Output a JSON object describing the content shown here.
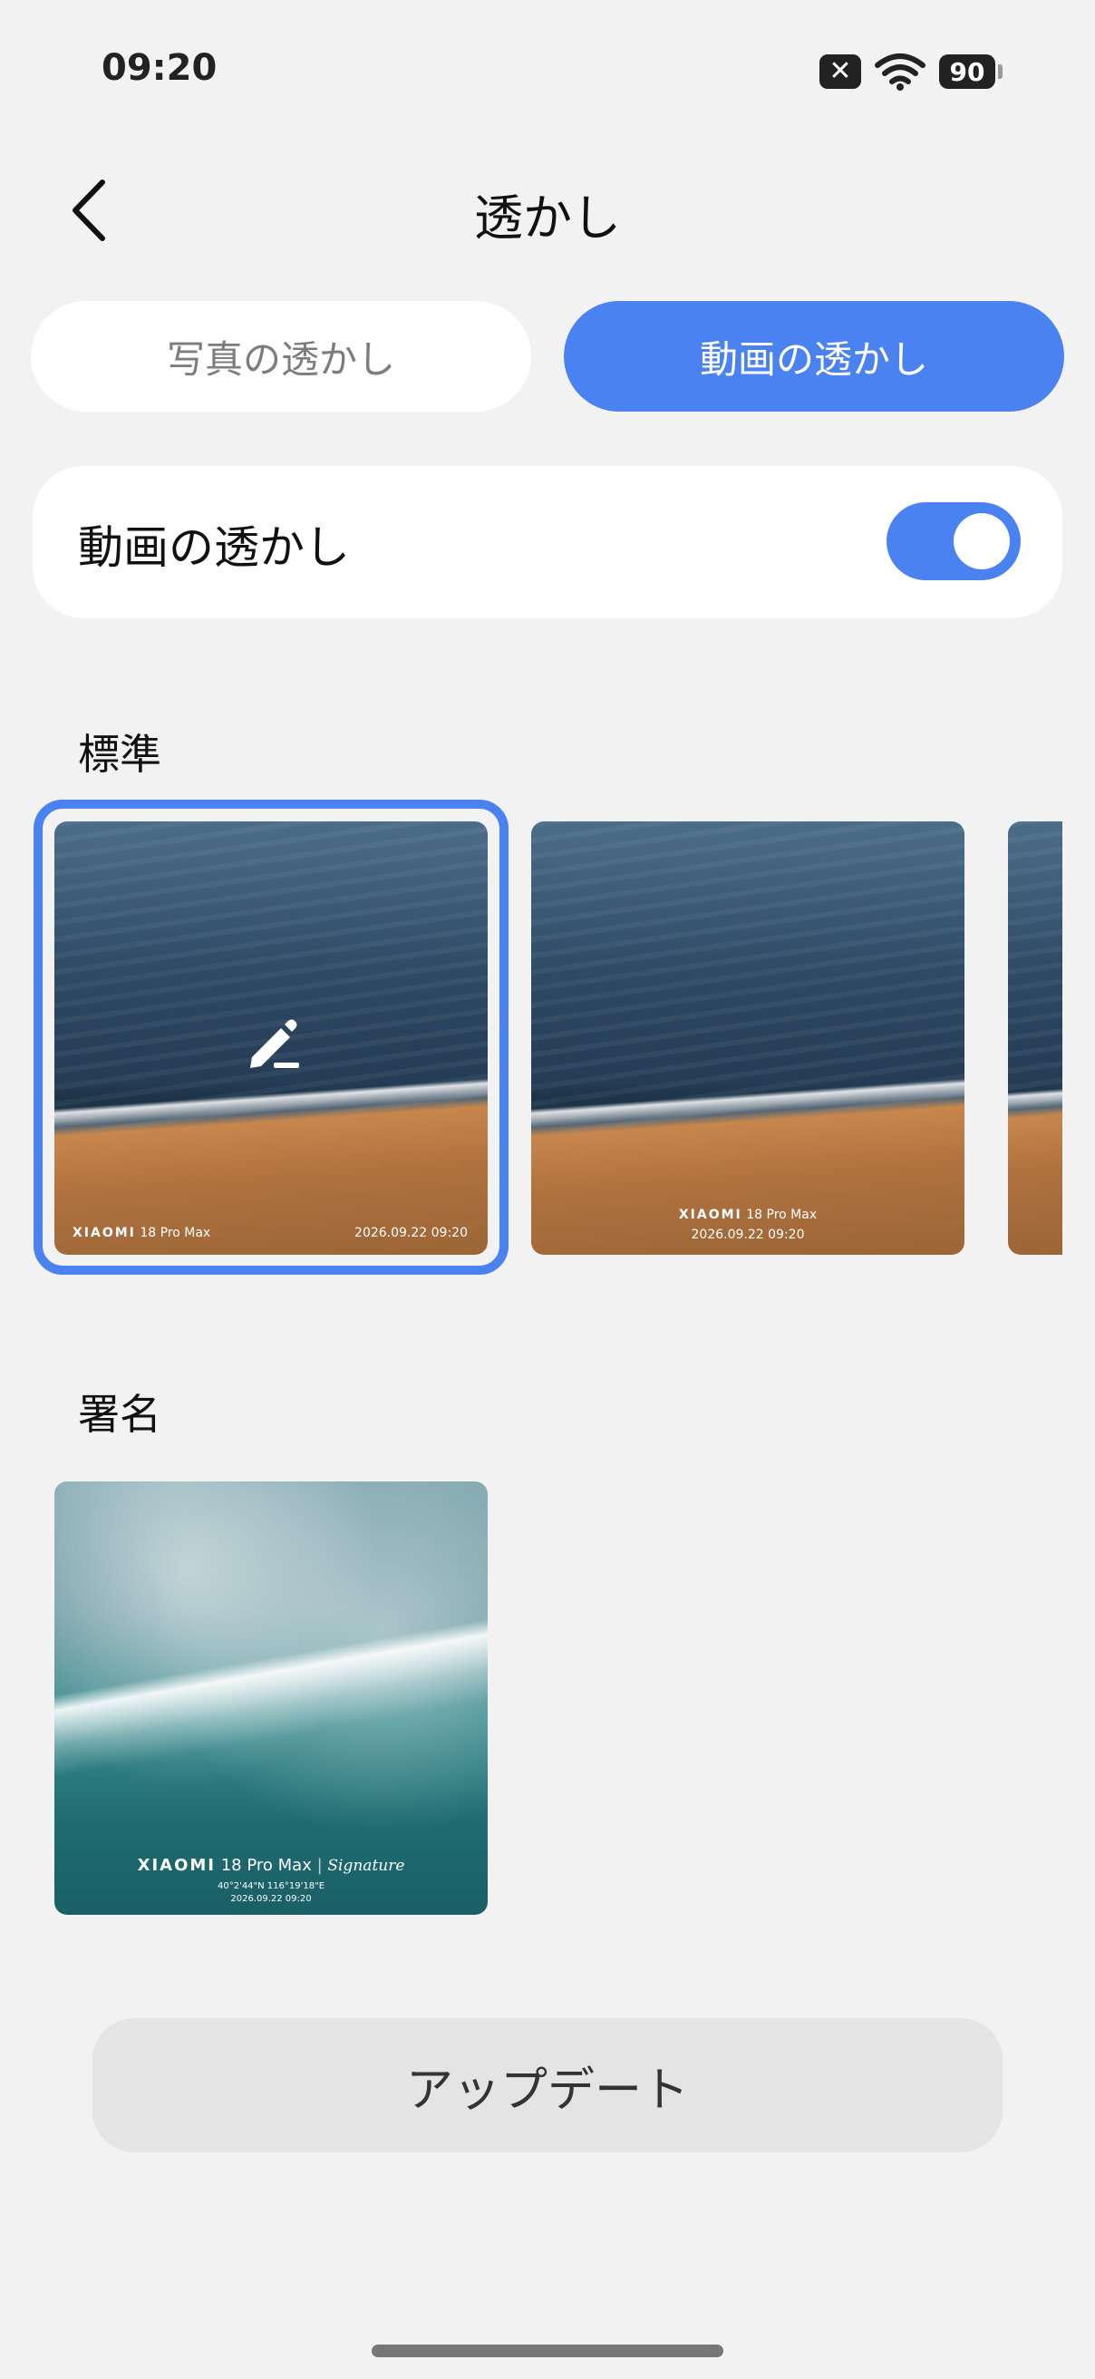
{
  "status_bar": {
    "time": "09:20",
    "sim_icon_glyph": "✕",
    "battery_level": "90"
  },
  "header": {
    "back_icon": "chevron-left-icon",
    "title": "透かし"
  },
  "tabs": [
    {
      "label": "写真の透かし",
      "active": false
    },
    {
      "label": "動画の透かし",
      "active": true
    }
  ],
  "toggle": {
    "label": "動画の透かし",
    "enabled": true
  },
  "sections": {
    "standard": {
      "label": "標準",
      "items": [
        {
          "brand": "XIAOMI",
          "model": "18 Pro Max",
          "datetime": "2026.09.22 09:20",
          "selected": true
        },
        {
          "brand": "XIAOMI",
          "model": "18 Pro Max",
          "datetime": "2026.09.22 09:20",
          "selected": false
        },
        {
          "selected": false
        }
      ]
    },
    "signature": {
      "label": "署名",
      "items": [
        {
          "brand": "XIAOMI",
          "model": "18 Pro Max",
          "script": "Signature",
          "coords": "40°2'44\"N  116°19'18\"E",
          "datetime": "2026.09.22 09:20"
        }
      ]
    }
  },
  "update_button": {
    "label": "アップデート"
  },
  "colors": {
    "accent": "#4a82f2",
    "background": "#f2f2f2",
    "card": "#ffffff",
    "button": "#e4e4e4"
  }
}
